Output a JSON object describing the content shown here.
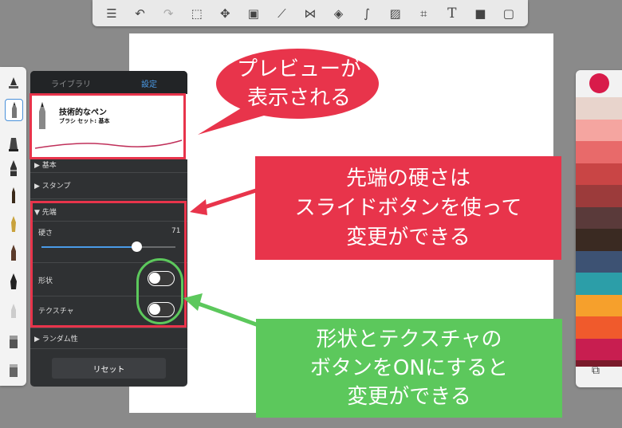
{
  "toolbar": {
    "icons": [
      "list-icon",
      "undo-icon",
      "redo-icon",
      "select-icon",
      "transform-icon",
      "layers-icon",
      "ruler-icon",
      "symmetry-icon",
      "shapes-icon",
      "curve-icon",
      "image-icon",
      "perspective-icon",
      "text-icon",
      "video-icon",
      "fullscreen-icon"
    ]
  },
  "panel": {
    "tab_library": "ライブラリ",
    "tab_settings": "設定",
    "brush_name": "技術的なペン",
    "brush_set": "ブラシ セット: 基本",
    "section_basic": "基本",
    "section_stamp": "スタンプ",
    "section_tip": "先端",
    "hardness_label": "硬さ",
    "hardness_value": "71",
    "hardness_fraction": 0.71,
    "shape_label": "形状",
    "shape_on": false,
    "texture_label": "テクスチャ",
    "texture_on": false,
    "section_random": "ランダム性",
    "reset_label": "リセット"
  },
  "colors": {
    "current": "#d81b4a",
    "swatches": [
      "#e8d4cc",
      "#f5a5a0",
      "#e86a6a",
      "#c94545",
      "#9c3b3b",
      "#5a3a3a",
      "#3a2a22",
      "#3d5273",
      "#2c9ea8",
      "#f6a02c",
      "#f05a2c",
      "#c81e50",
      "#7a1a2a"
    ]
  },
  "callouts": {
    "preview": [
      "プレビューが",
      "表示される"
    ],
    "tip": [
      "先端の硬さは",
      "スライドボタンを使って",
      "変更ができる"
    ],
    "toggle": [
      "形状とテクスチャの",
      "ボタンをONにすると",
      "変更ができる"
    ],
    "accent_red": "#e8344b",
    "accent_green": "#5cc85c"
  }
}
